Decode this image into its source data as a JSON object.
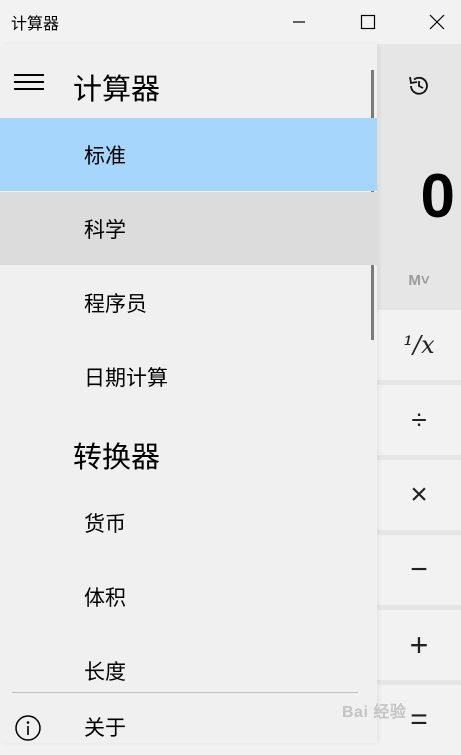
{
  "window": {
    "title": "计算器",
    "minimize_icon": "minimize-icon",
    "maximize_icon": "maximize-icon",
    "close_icon": "close-icon"
  },
  "nav": {
    "title": "计算器",
    "calculator_items": [
      {
        "label": "标准",
        "state": "selected"
      },
      {
        "label": "科学",
        "state": "hovered"
      },
      {
        "label": "程序员",
        "state": "normal"
      },
      {
        "label": "日期计算",
        "state": "normal"
      }
    ],
    "converter_header": "转换器",
    "converter_items": [
      {
        "label": "货币"
      },
      {
        "label": "体积"
      },
      {
        "label": "长度"
      }
    ],
    "about_label": "关于"
  },
  "calculator": {
    "display": "0",
    "memory_label": "M˅",
    "keys": [
      "¹/x",
      "÷",
      "×",
      "−",
      "+",
      "="
    ]
  },
  "watermark": {
    "text": "Bai 经验"
  },
  "colors": {
    "selected": "#a6d6fb",
    "hover": "#dcdcdc",
    "pane": "#f0f0f0",
    "calc_bg": "#e6e6e6"
  }
}
